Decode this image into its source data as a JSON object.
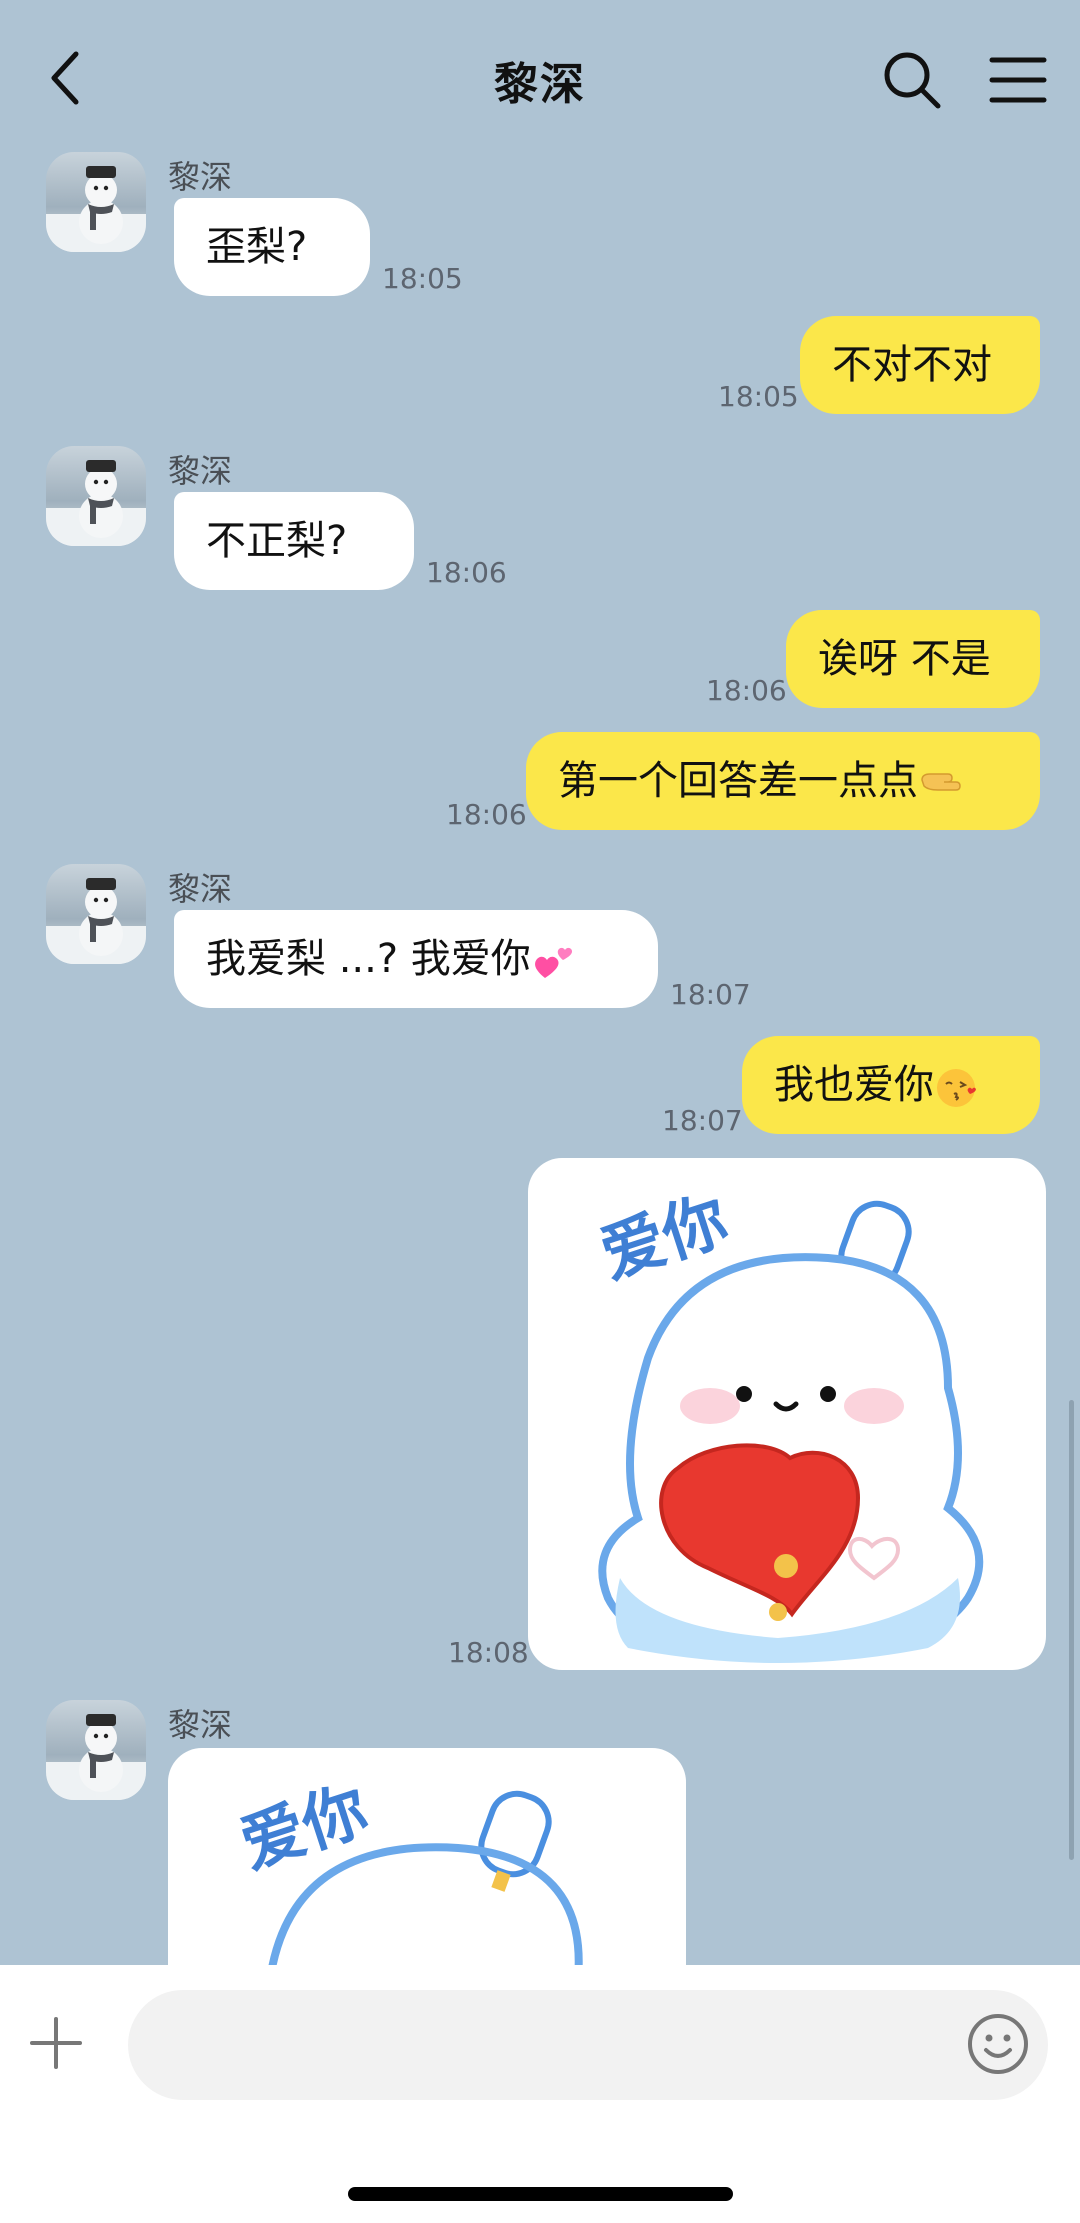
{
  "header": {
    "title": "黎深"
  },
  "contact": {
    "name": "黎深"
  },
  "messages": [
    {
      "dir": "in",
      "text": "歪梨?",
      "time": "18:05"
    },
    {
      "dir": "out",
      "text": "不对不对",
      "time": "18:05"
    },
    {
      "dir": "in",
      "text": "不正梨?",
      "time": "18:06"
    },
    {
      "dir": "out",
      "text": "诶呀 不是",
      "time": "18:06"
    },
    {
      "dir": "out",
      "text": "第一个回答差一点点",
      "emoji": "pointing-hand-emoji",
      "time": "18:06"
    },
    {
      "dir": "in",
      "text": "我爱梨 ...? 我爱你",
      "emoji": "two-hearts-emoji",
      "time": "18:07"
    },
    {
      "dir": "out",
      "text": "我也爱你",
      "emoji": "kiss-face-emoji",
      "time": "18:07"
    },
    {
      "dir": "out",
      "type": "sticker",
      "sticker_text": "爱你",
      "time": "18:08"
    },
    {
      "dir": "in",
      "type": "sticker",
      "sticker_text": "爱你"
    }
  ],
  "icons": {
    "back": "chevron-left-icon",
    "search": "search-icon",
    "menu": "menu-icon",
    "plus": "plus-icon",
    "emoji": "smiley-icon"
  },
  "colors": {
    "background": "#aec3d3",
    "outgoing_bubble": "#fbe74a",
    "incoming_bubble": "#ffffff",
    "sticker_blue": "#3f7fd4",
    "heart_red": "#e8382f"
  }
}
